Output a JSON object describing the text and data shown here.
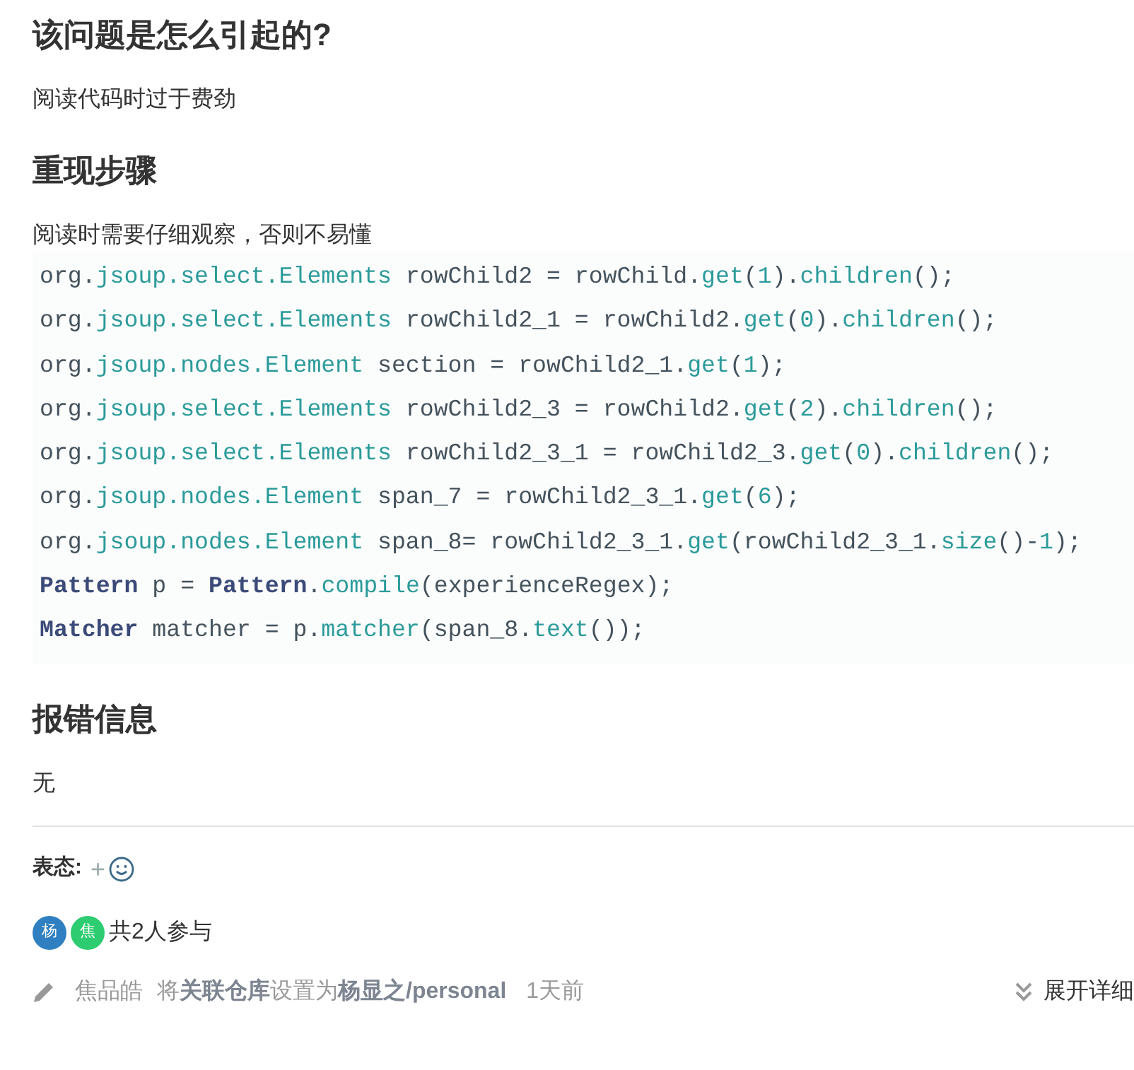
{
  "sections": [
    {
      "heading": "该问题是怎么引起的?",
      "body": "阅读代码时过于费劲"
    },
    {
      "heading": "重现步骤",
      "body": "阅读时需要仔细观察，否则不易懂",
      "code_lines": [
        [
          {
            "kind": "plain",
            "text": "org."
          },
          {
            "kind": "accent",
            "text": "jsoup.select.Elements"
          },
          {
            "kind": "plain",
            "text": " rowChild2 = rowChild."
          },
          {
            "kind": "accent",
            "text": "get"
          },
          {
            "kind": "plain",
            "text": "("
          },
          {
            "kind": "accent",
            "text": "1"
          },
          {
            "kind": "plain",
            "text": ")."
          },
          {
            "kind": "accent",
            "text": "children"
          },
          {
            "kind": "plain",
            "text": "();"
          }
        ],
        [
          {
            "kind": "plain",
            "text": "org."
          },
          {
            "kind": "accent",
            "text": "jsoup.select.Elements"
          },
          {
            "kind": "plain",
            "text": " rowChild2_1 = rowChild2."
          },
          {
            "kind": "accent",
            "text": "get"
          },
          {
            "kind": "plain",
            "text": "("
          },
          {
            "kind": "accent",
            "text": "0"
          },
          {
            "kind": "plain",
            "text": ")."
          },
          {
            "kind": "accent",
            "text": "children"
          },
          {
            "kind": "plain",
            "text": "();"
          }
        ],
        [
          {
            "kind": "plain",
            "text": "org."
          },
          {
            "kind": "accent",
            "text": "jsoup.nodes.Element"
          },
          {
            "kind": "plain",
            "text": " section = rowChild2_1."
          },
          {
            "kind": "accent",
            "text": "get"
          },
          {
            "kind": "plain",
            "text": "("
          },
          {
            "kind": "accent",
            "text": "1"
          },
          {
            "kind": "plain",
            "text": ");"
          }
        ],
        [
          {
            "kind": "plain",
            "text": "org."
          },
          {
            "kind": "accent",
            "text": "jsoup.select.Elements"
          },
          {
            "kind": "plain",
            "text": " rowChild2_3 = rowChild2."
          },
          {
            "kind": "accent",
            "text": "get"
          },
          {
            "kind": "plain",
            "text": "("
          },
          {
            "kind": "accent",
            "text": "2"
          },
          {
            "kind": "plain",
            "text": ")."
          },
          {
            "kind": "accent",
            "text": "children"
          },
          {
            "kind": "plain",
            "text": "();"
          }
        ],
        [
          {
            "kind": "plain",
            "text": "org."
          },
          {
            "kind": "accent",
            "text": "jsoup.select.Elements"
          },
          {
            "kind": "plain",
            "text": " rowChild2_3_1 = rowChild2_3."
          },
          {
            "kind": "accent",
            "text": "get"
          },
          {
            "kind": "plain",
            "text": "("
          },
          {
            "kind": "accent",
            "text": "0"
          },
          {
            "kind": "plain",
            "text": ")."
          },
          {
            "kind": "accent",
            "text": "children"
          },
          {
            "kind": "plain",
            "text": "();"
          }
        ],
        [
          {
            "kind": "plain",
            "text": "org."
          },
          {
            "kind": "accent",
            "text": "jsoup.nodes.Element"
          },
          {
            "kind": "plain",
            "text": " span_7 = rowChild2_3_1."
          },
          {
            "kind": "accent",
            "text": "get"
          },
          {
            "kind": "plain",
            "text": "("
          },
          {
            "kind": "accent",
            "text": "6"
          },
          {
            "kind": "plain",
            "text": ");"
          }
        ],
        [
          {
            "kind": "plain",
            "text": "org."
          },
          {
            "kind": "accent",
            "text": "jsoup.nodes.Element"
          },
          {
            "kind": "plain",
            "text": " span_8= rowChild2_3_1."
          },
          {
            "kind": "accent",
            "text": "get"
          },
          {
            "kind": "plain",
            "text": "(rowChild2_3_1."
          },
          {
            "kind": "accent",
            "text": "size"
          },
          {
            "kind": "plain",
            "text": "()-"
          },
          {
            "kind": "accent",
            "text": "1"
          },
          {
            "kind": "plain",
            "text": ");"
          }
        ],
        [
          {
            "kind": "type",
            "text": "Pattern"
          },
          {
            "kind": "plain",
            "text": " p = "
          },
          {
            "kind": "type",
            "text": "Pattern"
          },
          {
            "kind": "plain",
            "text": "."
          },
          {
            "kind": "accent",
            "text": "compile"
          },
          {
            "kind": "plain",
            "text": "(experienceRegex);"
          }
        ],
        [
          {
            "kind": "type",
            "text": "Matcher"
          },
          {
            "kind": "plain",
            "text": " matcher = p."
          },
          {
            "kind": "accent",
            "text": "matcher"
          },
          {
            "kind": "plain",
            "text": "(span_8."
          },
          {
            "kind": "accent",
            "text": "text"
          },
          {
            "kind": "plain",
            "text": "());"
          }
        ]
      ]
    },
    {
      "heading": "报错信息",
      "body": "无"
    }
  ],
  "reactions": {
    "label": "表态:",
    "add": "+"
  },
  "participants": {
    "avatars": [
      {
        "initial": "杨",
        "color": "#2f7fc1"
      },
      {
        "initial": "焦",
        "color": "#2ecc71"
      }
    ],
    "summary": "共2人参与"
  },
  "activity": {
    "user": "焦品皓",
    "action": "将**关联仓库**设置为**杨显之/personal**",
    "time": "1天前",
    "expand": "展开详细"
  }
}
